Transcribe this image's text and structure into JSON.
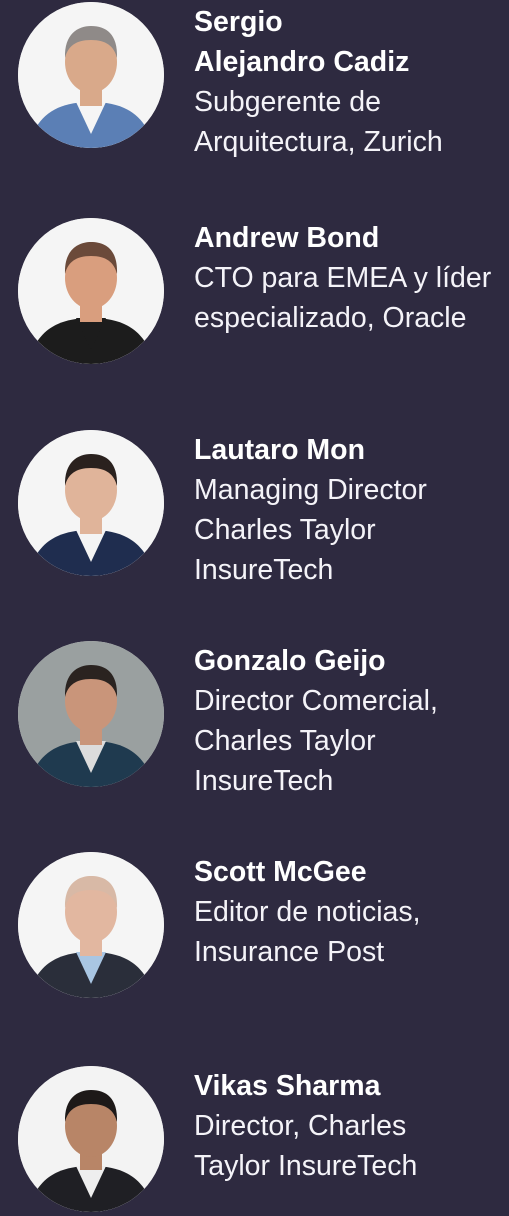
{
  "speakers": [
    {
      "name_lines": [
        "Sergio",
        "Alejandro Cadiz"
      ],
      "role_lines": [
        "Subgerente de",
        "Arquitectura, Zurich"
      ],
      "avatar_icon": "person-photo-icon",
      "bg": "#f5f5f5",
      "skin": "#d9a98a",
      "hair": "#8f8a88",
      "shirt": "#f5f5f5",
      "jacket": "#5b7fb5"
    },
    {
      "name_lines": [
        "Andrew Bond"
      ],
      "role_lines": [
        "CTO para EMEA y líder",
        "especializado, Oracle"
      ],
      "avatar_icon": "person-photo-icon",
      "bg": "#f5f5f5",
      "skin": "#d99e7e",
      "hair": "#6b4a3a",
      "shirt": "#1c1c1c",
      "jacket": "#1c1c1c"
    },
    {
      "name_lines": [
        "Lautaro Mon"
      ],
      "role_lines": [
        "Managing Director",
        "Charles Taylor",
        "InsureTech"
      ],
      "avatar_icon": "person-photo-icon",
      "bg": "#f5f5f5",
      "skin": "#e0b49a",
      "hair": "#2a211e",
      "shirt": "#f4f4f4",
      "jacket": "#1f2d4f"
    },
    {
      "name_lines": [
        "Gonzalo Geijo"
      ],
      "role_lines": [
        "Director Comercial,",
        "Charles Taylor",
        "InsureTech"
      ],
      "avatar_icon": "person-photo-icon",
      "bg": "#9aa0a0",
      "skin": "#c9957a",
      "hair": "#2a2320",
      "shirt": "#dcdcdc",
      "jacket": "#1f3a4f"
    },
    {
      "name_lines": [
        "Scott McGee"
      ],
      "role_lines": [
        "Editor de noticias,",
        "Insurance Post"
      ],
      "avatar_icon": "person-photo-icon",
      "bg": "#f5f5f5",
      "skin": "#e2b7a0",
      "hair": "#d8b9a6",
      "shirt": "#a9c6e3",
      "jacket": "#2a2e3a"
    },
    {
      "name_lines": [
        "Vikas Sharma"
      ],
      "role_lines": [
        "Director, Charles",
        "Taylor InsureTech"
      ],
      "avatar_icon": "person-photo-icon",
      "bg": "#f3f3f3",
      "skin": "#b88567",
      "hair": "#1d1918",
      "shirt": "#eeeeee",
      "jacket": "#1f1f24"
    }
  ]
}
